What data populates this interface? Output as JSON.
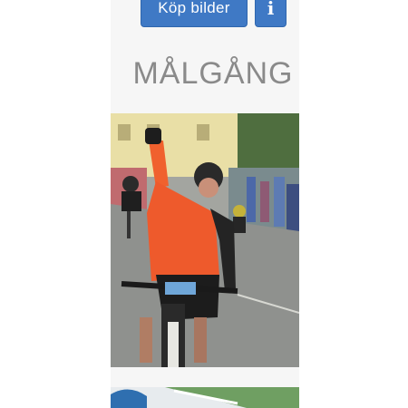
{
  "buttons": {
    "buy_label": "Köp bilder",
    "info_label": "i"
  },
  "section": {
    "title": "MÅLGÅNG"
  },
  "photos": [
    {
      "alt": "cyclist at finish"
    },
    {
      "alt": "next photo"
    }
  ],
  "colors": {
    "button_bg": "#3f79c5",
    "title_text": "#8a8a8a"
  }
}
